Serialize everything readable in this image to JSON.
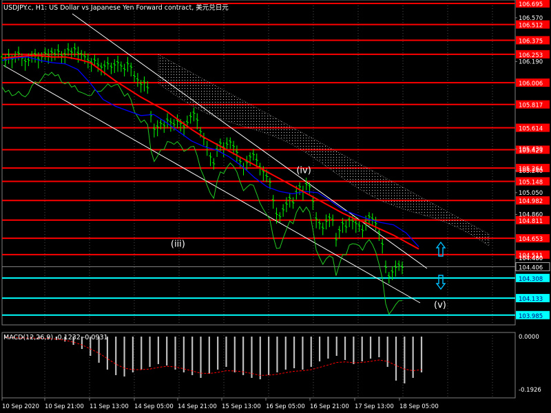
{
  "title": "USDJPY.c, H1:  US Dollar vs Japanese Yen Forward contract, 美元兑日元",
  "colors": {
    "background": "#000000",
    "grid": "#505050",
    "price_up": "#00ff00",
    "resistance": "#ff0000",
    "support": "#00ffff",
    "ma_red": "#ff0000",
    "ma_blue": "#0000ff",
    "channel": "#ffffff",
    "macd_hist": "#c0c0c0",
    "macd_signal": "#ff0000",
    "arrow": "#00bfff"
  },
  "chart_data": [
    {
      "type": "line",
      "title": "USDJPY.c, H1:  US Dollar vs Japanese Yen Forward contract, 美元兑日元",
      "xlabel": "",
      "ylabel": "",
      "ylim": [
        103.9,
        106.695
      ],
      "x_ticks": [
        "10 Sep 2020",
        "10 Sep 21:00",
        "11 Sep 13:00",
        "14 Sep 05:00",
        "14 Sep 21:00",
        "15 Sep 13:00",
        "16 Sep 05:00",
        "16 Sep 21:00",
        "17 Sep 13:00",
        "18 Sep 05:00"
      ],
      "y_ticks": [
        "106.570",
        "106.190",
        "105.430",
        "105.240",
        "105.050",
        "104.860",
        "104.480"
      ],
      "price_series": {
        "name": "",
        "values": [
          106.22,
          106.2,
          106.24,
          106.21,
          106.23,
          106.26,
          106.22,
          106.19,
          106.2,
          106.24,
          106.25,
          106.21,
          106.23,
          106.26,
          106.24,
          106.27,
          106.25,
          106.28,
          106.24,
          106.25,
          106.29,
          106.27,
          106.3,
          106.26,
          106.25,
          106.23,
          106.2,
          106.18,
          106.2,
          106.16,
          106.14,
          106.15,
          106.17,
          106.14,
          106.16,
          106.18,
          106.15,
          106.12,
          106.17,
          106.14,
          106.06,
          106.03,
          105.99,
          106.01,
          105.96,
          105.72,
          105.6,
          105.62,
          105.65,
          105.63,
          105.68,
          105.66,
          105.64,
          105.67,
          105.65,
          105.62,
          105.66,
          105.71,
          105.74,
          105.68,
          105.58,
          105.52,
          105.44,
          105.36,
          105.3,
          105.42,
          105.48,
          105.44,
          105.47,
          105.49,
          105.45,
          105.4,
          105.32,
          105.26,
          105.31,
          105.36,
          105.38,
          105.33,
          105.27,
          105.23,
          105.19,
          105.14,
          104.98,
          104.86,
          104.84,
          104.9,
          104.95,
          105.0,
          104.96,
          105.05,
          105.1,
          105.06,
          105.12,
          105.1,
          104.97,
          104.82,
          104.78,
          104.74,
          104.8,
          104.83,
          104.81,
          104.64,
          104.72,
          104.78,
          104.75,
          104.81,
          104.8,
          104.78,
          104.76,
          104.72,
          104.79,
          104.84,
          104.82,
          104.78,
          104.7,
          104.6,
          104.4,
          104.32,
          104.36,
          104.4,
          104.42,
          104.4
        ]
      },
      "ma_red": {
        "name": "",
        "values": [
          106.22,
          106.23,
          106.24,
          106.24,
          106.23,
          106.23,
          106.21,
          106.18,
          106.1,
          106.02,
          105.95,
          105.88,
          105.82,
          105.76,
          105.68,
          105.6,
          105.53,
          105.47,
          105.41,
          105.35,
          105.29,
          105.23,
          105.17,
          105.11,
          105.05,
          104.99,
          104.93,
          104.87,
          104.82,
          104.78,
          104.73,
          104.68,
          104.62,
          104.56
        ]
      },
      "ma_blue": {
        "name": "",
        "values": [
          106.2,
          106.22,
          106.23,
          106.2,
          106.18,
          106.17,
          106.12,
          106.0,
          105.86,
          105.8,
          105.76,
          105.72,
          105.73,
          105.66,
          105.58,
          105.5,
          105.45,
          105.42,
          105.36,
          105.28,
          105.18,
          105.1,
          105.06,
          105.04,
          105.06,
          105.05,
          104.98,
          104.9,
          104.86,
          104.82,
          104.79,
          104.77,
          104.7,
          104.58
        ]
      },
      "horizontal_levels": [
        {
          "value": 106.695,
          "label": "106.695",
          "kind": "resistance"
        },
        {
          "value": 106.512,
          "label": "106.512",
          "kind": "resistance"
        },
        {
          "value": 106.375,
          "label": "106.375",
          "kind": "resistance"
        },
        {
          "value": 106.253,
          "label": "106.253",
          "kind": "resistance"
        },
        {
          "value": 106.006,
          "label": "106.006",
          "kind": "resistance"
        },
        {
          "value": 105.817,
          "label": "105.817",
          "kind": "resistance"
        },
        {
          "value": 105.614,
          "label": "105.614",
          "kind": "resistance"
        },
        {
          "value": 105.423,
          "label": "105.423",
          "kind": "resistance"
        },
        {
          "value": 105.264,
          "label": "105.264",
          "kind": "resistance"
        },
        {
          "value": 105.148,
          "label": "105.148",
          "kind": "resistance"
        },
        {
          "value": 104.982,
          "label": "104.982",
          "kind": "resistance"
        },
        {
          "value": 104.811,
          "label": "104.811",
          "kind": "resistance"
        },
        {
          "value": 104.653,
          "label": "104.653",
          "kind": "resistance"
        },
        {
          "value": 104.511,
          "label": "104.511",
          "kind": "resistance"
        },
        {
          "value": 104.308,
          "label": "104.308",
          "kind": "support"
        },
        {
          "value": 104.133,
          "label": "104.133",
          "kind": "support"
        },
        {
          "value": 103.985,
          "label": "103.985",
          "kind": "support"
        }
      ],
      "current_price": {
        "value": 104.406,
        "label": "104.406"
      },
      "wave_labels": [
        {
          "text": "(iii)",
          "index": 51,
          "value": 104.58
        },
        {
          "text": "(iv)",
          "index": 89,
          "value": 105.22
        },
        {
          "text": "(v)",
          "index": 124,
          "value": 104.05
        }
      ]
    },
    {
      "type": "bar",
      "title": "MACD(12,26,9) -0.1232 -0.0931",
      "xlabel": "",
      "ylabel": "",
      "ylim": [
        -0.1926,
        0.0
      ],
      "y_ticks": [
        "0.0000",
        "-0.1926"
      ],
      "series": [
        {
          "name": "",
          "values": [
            -0.004,
            -0.005,
            -0.006,
            -0.005,
            -0.007,
            -0.008,
            -0.012,
            -0.018,
            -0.03,
            -0.045,
            -0.07,
            -0.095,
            -0.12,
            -0.14,
            -0.145,
            -0.13,
            -0.12,
            -0.11,
            -0.1,
            -0.105,
            -0.12,
            -0.13,
            -0.14,
            -0.15,
            -0.135,
            -0.12,
            -0.11,
            -0.13,
            -0.14,
            -0.15,
            -0.155,
            -0.14,
            -0.13,
            -0.12,
            -0.115,
            -0.12,
            -0.11,
            -0.09,
            -0.08,
            -0.07,
            -0.085,
            -0.1,
            -0.09,
            -0.08,
            -0.075,
            -0.11,
            -0.16,
            -0.17,
            -0.15,
            -0.13
          ]
        },
        {
          "name": "",
          "values": [
            -0.003,
            -0.004,
            -0.005,
            -0.005,
            -0.006,
            -0.007,
            -0.009,
            -0.013,
            -0.02,
            -0.03,
            -0.045,
            -0.06,
            -0.08,
            -0.1,
            -0.115,
            -0.12,
            -0.12,
            -0.118,
            -0.112,
            -0.108,
            -0.11,
            -0.117,
            -0.125,
            -0.133,
            -0.134,
            -0.13,
            -0.124,
            -0.125,
            -0.128,
            -0.134,
            -0.141,
            -0.14,
            -0.137,
            -0.131,
            -0.126,
            -0.124,
            -0.12,
            -0.112,
            -0.103,
            -0.094,
            -0.092,
            -0.095,
            -0.094,
            -0.09,
            -0.085,
            -0.09,
            -0.105,
            -0.118,
            -0.124,
            -0.12
          ]
        }
      ]
    }
  ],
  "wave_labels": [
    "(iii)",
    "(iv)",
    "(v)"
  ],
  "extra_price_labels": {
    "p1": "104.480"
  }
}
